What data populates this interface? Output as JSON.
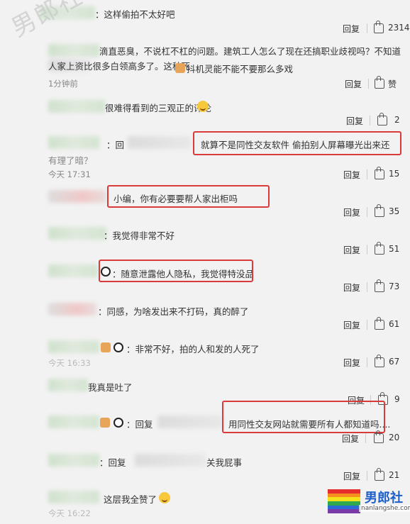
{
  "watermark": "男郎社",
  "logo": {
    "name": "男郎社",
    "sub": "nanlangshe.com",
    "colors": [
      "#e52d2d",
      "#f58f1d",
      "#f6e21b",
      "#2fa84f",
      "#2c6bd6",
      "#7a3aa8"
    ]
  },
  "ui": {
    "reply_label": "回复",
    "red_box_color": "#d93b3b"
  },
  "comments": [
    {
      "text": "：这样偷拍不太好吧",
      "time": "",
      "count": "2314"
    },
    {
      "text": "滴直恶臭，不说杠不杠的问题。建筑工人怎么了现在还搞职业歧视吗？不知道人家上资比很多白领高多了。这种死",
      "text2": "抖机灵能不能不要那么多戏",
      "time": "1分钟前",
      "count": "赞"
    },
    {
      "text": "很难得看到的三观正的评论",
      "time": "",
      "count": "2"
    },
    {
      "text": "就算不是同性交友软件 偷拍别人屏幕曝光出来还",
      "prefix": "：回",
      "overflow": "有理了暗？",
      "time": "今天 17:31",
      "count": "15"
    },
    {
      "text": "小编，你有必要要帮人家出柜吗",
      "time": "",
      "count": "35"
    },
    {
      "text": "：我觉得非常不好",
      "time": "",
      "count": "51"
    },
    {
      "text": "：随意泄露他人隐私，我觉得特没品",
      "time": "",
      "count": "73"
    },
    {
      "text": "：同感，为啥发出来不打码，真的醉了",
      "time": "",
      "count": "61"
    },
    {
      "text": "：非常不好，拍的人和发的人死了",
      "time": "今天 16:33",
      "count": "67"
    },
    {
      "text": "我真是吐了",
      "time": "",
      "count": "9"
    },
    {
      "text": "用同性交友网站就需要所有人都知道吗....",
      "prefix": "：回复",
      "time": "",
      "count": "20"
    },
    {
      "text": "关我屁事",
      "prefix": "：回复",
      "time": "",
      "count": "21"
    },
    {
      "text": "这层我全赞了",
      "time": "今天 16:22",
      "count": ""
    }
  ]
}
